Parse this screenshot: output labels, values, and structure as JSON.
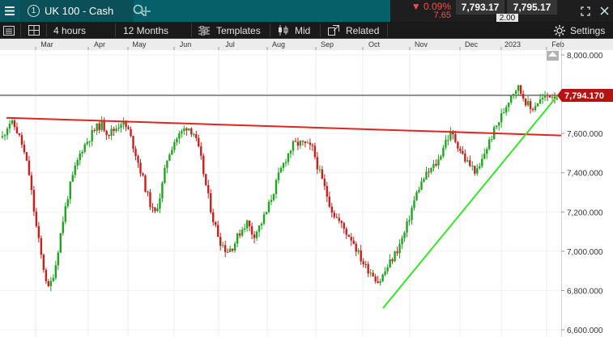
{
  "header": {
    "tab_number": "1",
    "instrument": "UK 100 - Cash",
    "change_pct": "▼ 0.09%",
    "change_abs": "7.65",
    "sell_price": "7,793.17",
    "buy_price": "7,795.17",
    "spread": "2.00"
  },
  "toolbar": {
    "interval": "4 hours",
    "range": "12 Months",
    "templates": "Templates",
    "price_mode": "Mid",
    "related": "Related",
    "settings": "Settings"
  },
  "colors": {
    "up_candle": "#1fa51f",
    "down_candle": "#c8201f",
    "resistance_line": "#e0241f",
    "support_line": "#33e62b",
    "price_label_bg": "#b51212"
  },
  "chart_data": {
    "type": "line",
    "x_labels": [
      "Mar",
      "Apr",
      "May",
      "Jun",
      "Jul",
      "Aug",
      "Sep",
      "Oct",
      "Nov",
      "Dec",
      "2023",
      "Feb"
    ],
    "y_tick_labels": [
      "8,000.000",
      "7,800.000",
      "7,600.000",
      "7,400.000",
      "7,200.000",
      "7,000.000",
      "6,800.000",
      "6,600.000"
    ],
    "ylim": [
      6600,
      8000
    ],
    "current_price": "7,794.170",
    "series": [
      {
        "values": [
          7580,
          7660,
          7630,
          7540,
          7400,
          7150,
          6950,
          6800,
          6920,
          7130,
          7300,
          7420,
          7520,
          7570,
          7620,
          7650,
          7600,
          7620,
          7660,
          7620,
          7520,
          7400,
          7280,
          7180,
          7300,
          7480,
          7560,
          7600,
          7640,
          7600,
          7480,
          7300,
          7150,
          7050,
          7000,
          7030,
          7100,
          7150,
          7080,
          7130,
          7200,
          7300,
          7400,
          7480,
          7540,
          7550,
          7540,
          7520,
          7400,
          7300,
          7200,
          7150,
          7100,
          7060,
          6980,
          6920,
          6890,
          6840,
          6900,
          6960,
          7020,
          7100,
          7220,
          7320,
          7380,
          7420,
          7460,
          7560,
          7600,
          7540,
          7470,
          7430,
          7400,
          7500,
          7580,
          7650,
          7720,
          7800,
          7840,
          7780,
          7720,
          7760,
          7780,
          7800,
          7790
        ]
      }
    ],
    "annotations": [
      {
        "type": "trendline",
        "name": "resistance",
        "from": {
          "x": "Feb",
          "y": 7680
        },
        "to": {
          "x": "Feb 2023",
          "y": 7590
        }
      },
      {
        "type": "trendline",
        "name": "support",
        "from": {
          "x": "Oct",
          "y": 6710
        },
        "to": {
          "x": "Feb 2023",
          "y": 7790
        }
      }
    ]
  }
}
